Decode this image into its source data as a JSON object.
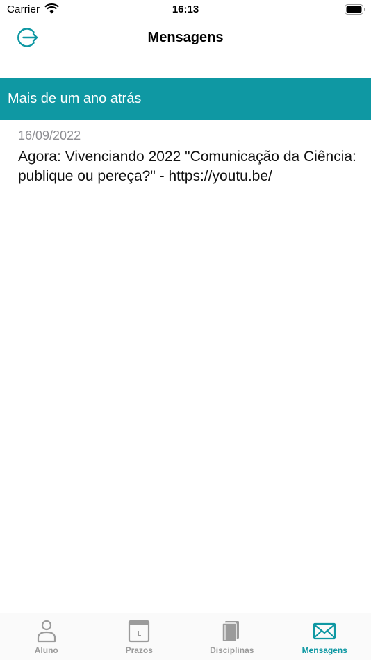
{
  "status_bar": {
    "carrier": "Carrier",
    "time": "16:13"
  },
  "nav": {
    "title": "Mensagens",
    "logout_icon": "logout-icon"
  },
  "section": {
    "title": "Mais de um ano atrás"
  },
  "messages": [
    {
      "date": "16/09/2022",
      "text": "Agora: Vivenciando 2022 \"Comunicação da Ciência: publique ou pereça?\" - https://youtu.be/"
    }
  ],
  "tabs": [
    {
      "label": "Aluno",
      "icon": "person-icon",
      "active": false
    },
    {
      "label": "Prazos",
      "icon": "calendar-icon",
      "active": false
    },
    {
      "label": "Disciplinas",
      "icon": "book-icon",
      "active": false
    },
    {
      "label": "Mensagens",
      "icon": "envelope-icon",
      "active": true
    }
  ],
  "colors": {
    "accent": "#0F98A3",
    "inactive": "#9B9B9B",
    "date": "#8E8E93"
  }
}
